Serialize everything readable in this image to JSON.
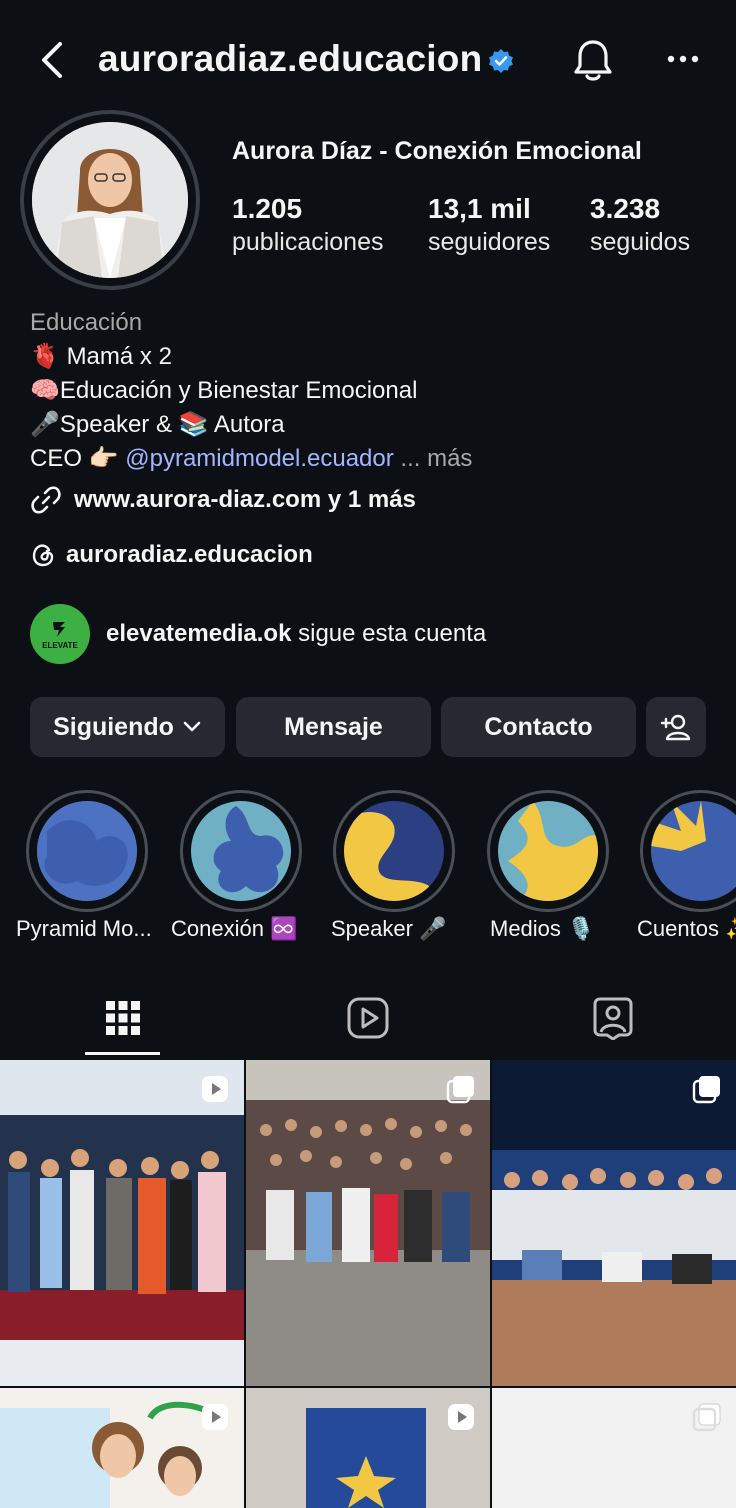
{
  "header": {
    "username": "auroradiaz.educacion",
    "icons": [
      "back-arrow-icon",
      "verified-badge-icon",
      "bell-icon",
      "more-icon"
    ]
  },
  "profile": {
    "full_name": "Aurora Díaz - Conexión Emocional",
    "stats": [
      {
        "value": "1.205",
        "label": "publicaciones"
      },
      {
        "value": "13,1 mil",
        "label": "seguidores"
      },
      {
        "value": "3.238",
        "label": "seguidos"
      }
    ],
    "category": "Educación",
    "bio": {
      "line1_emoji": "🫀",
      "line1": "Mamá x 2",
      "line2_emoji": "🧠",
      "line2": "Educación y Bienestar Emocional",
      "line3_emoji1": "🎤",
      "line3_a": "Speaker &",
      "line3_emoji2": "📚",
      "line3_b": "Autora",
      "line4_prefix": "CEO",
      "line4_emoji": "👉🏻",
      "mention": "@pyramidmodel.ecuador",
      "more": "... más"
    },
    "link": "www.aurora-diaz.com y 1 más",
    "threads": "auroradiaz.educacion",
    "followed_by_user": "elevatemedia.ok",
    "followed_by_text": "sigue esta cuenta",
    "elevate_logo_text": "ELEVATE"
  },
  "buttons": {
    "following": "Siguiendo",
    "message": "Mensaje",
    "contact": "Contacto"
  },
  "highlights": [
    {
      "label": "Pyramid Mo..."
    },
    {
      "label": "Conexión ♾️"
    },
    {
      "label": "Speaker 🎤"
    },
    {
      "label": "Medios 🎙️"
    },
    {
      "label": "Cuentos ✨"
    }
  ],
  "tabs": [
    "grid-icon",
    "reels-icon",
    "tagged-icon"
  ],
  "colors": {
    "background": "#0c1014",
    "button": "#262a30",
    "mention": "#a5b4ff",
    "verified": "#3897f0",
    "highlight_blue": "#3d5fae",
    "highlight_yellow": "#f2c744",
    "highlight_teal": "#6fb0c4"
  }
}
